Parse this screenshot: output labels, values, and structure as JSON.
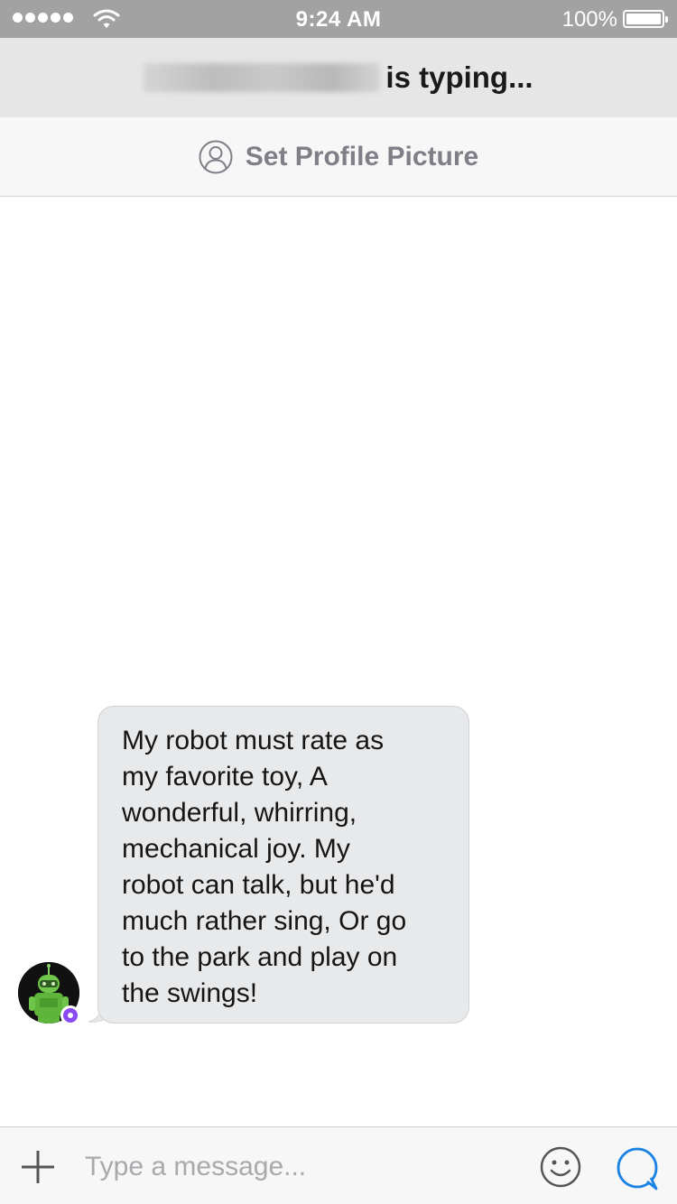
{
  "status_bar": {
    "time": "9:24 AM",
    "battery_percent": "100%",
    "signal_icon": "signal-dots-icon",
    "wifi_icon": "wifi-icon",
    "battery_icon": "battery-icon",
    "battery_level": 1.0
  },
  "header": {
    "typing_text": "is typing..."
  },
  "profile_bar": {
    "icon": "user-circle-icon",
    "label": "Set Profile Picture"
  },
  "messages": [
    {
      "sender": "bot",
      "avatar_icon": "robot-avatar-icon",
      "badge_icon": "bot-badge-icon",
      "text": "My robot must rate as\nmy favorite toy,  A\nwonderful, whirring,\nmechanical joy.  My\nrobot can talk, but he'd\nmuch rather sing,  Or go\nto the park and play on\nthe swings!"
    }
  ],
  "composer": {
    "placeholder": "Type a message...",
    "value": "",
    "plus_icon": "plus-icon",
    "emoji_icon": "emoji-icon",
    "send_icon": "chat-bubble-icon"
  },
  "colors": {
    "status_bar_bg": "#a2a2a2",
    "header_bg": "#e6e6e6",
    "bubble_bg": "#e8e9eb",
    "accent_blue": "#1a82e2",
    "badge_purple": "#8a4af3",
    "robot_green": "#6fc64a"
  }
}
